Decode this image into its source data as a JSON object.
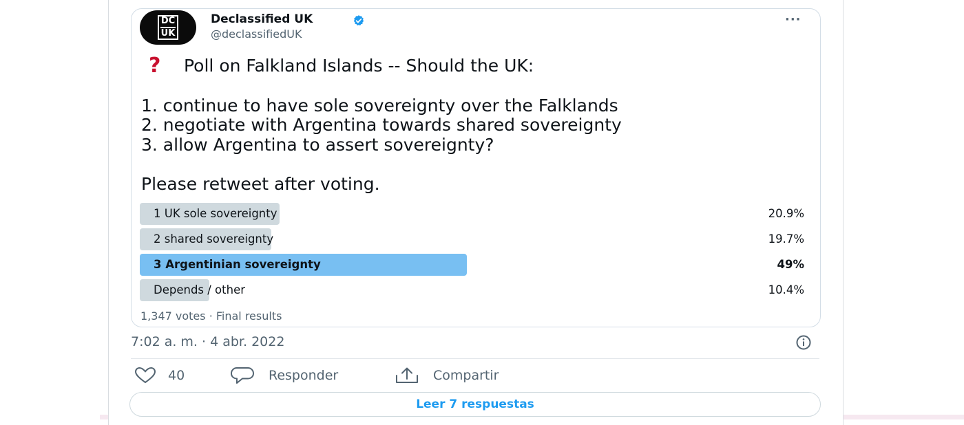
{
  "author": {
    "name": "Declassified UK",
    "handle": "@declassifiedUK",
    "avatar_text_top": "DC",
    "avatar_text_bottom": "UK",
    "verified": true
  },
  "tweet": {
    "question_mark": "❓",
    "headline": "Poll on Falkland Islands -- Should the UK:",
    "options_text": [
      "1. continue to have sole sovereignty over the Falklands",
      "2. negotiate with Argentina towards shared sovereignty",
      "3. allow Argentina to assert sovereignty?"
    ],
    "cta": "Please retweet after voting."
  },
  "poll": {
    "options": [
      {
        "label": "1 UK sole sovereignty",
        "percent_text": "20.9%",
        "percent": 20.9,
        "winner": false
      },
      {
        "label": "2 shared sovereignty",
        "percent_text": "19.7%",
        "percent": 19.7,
        "winner": false
      },
      {
        "label": "3 Argentinian sovereignty",
        "percent_text": "49%",
        "percent": 49,
        "winner": true
      },
      {
        "label": "Depends / other",
        "percent_text": "10.4%",
        "percent": 10.4,
        "winner": false
      }
    ],
    "meta": "1,347 votes · Final results"
  },
  "timestamp": "7:02 a. m. · 4 abr. 2022",
  "actions": {
    "likes_count": "40",
    "reply_label": "Responder",
    "share_label": "Compartir"
  },
  "read_replies_label": "Leer 7 respuestas",
  "colors": {
    "accent": "#1d9bf0",
    "poll_winner": "#78bff2",
    "poll_bar": "#cfd9de",
    "question_mark": "#c8102e"
  },
  "icons": [
    "more-icon",
    "verified-badge-icon",
    "info-icon",
    "heart-icon",
    "reply-icon",
    "share-icon"
  ]
}
